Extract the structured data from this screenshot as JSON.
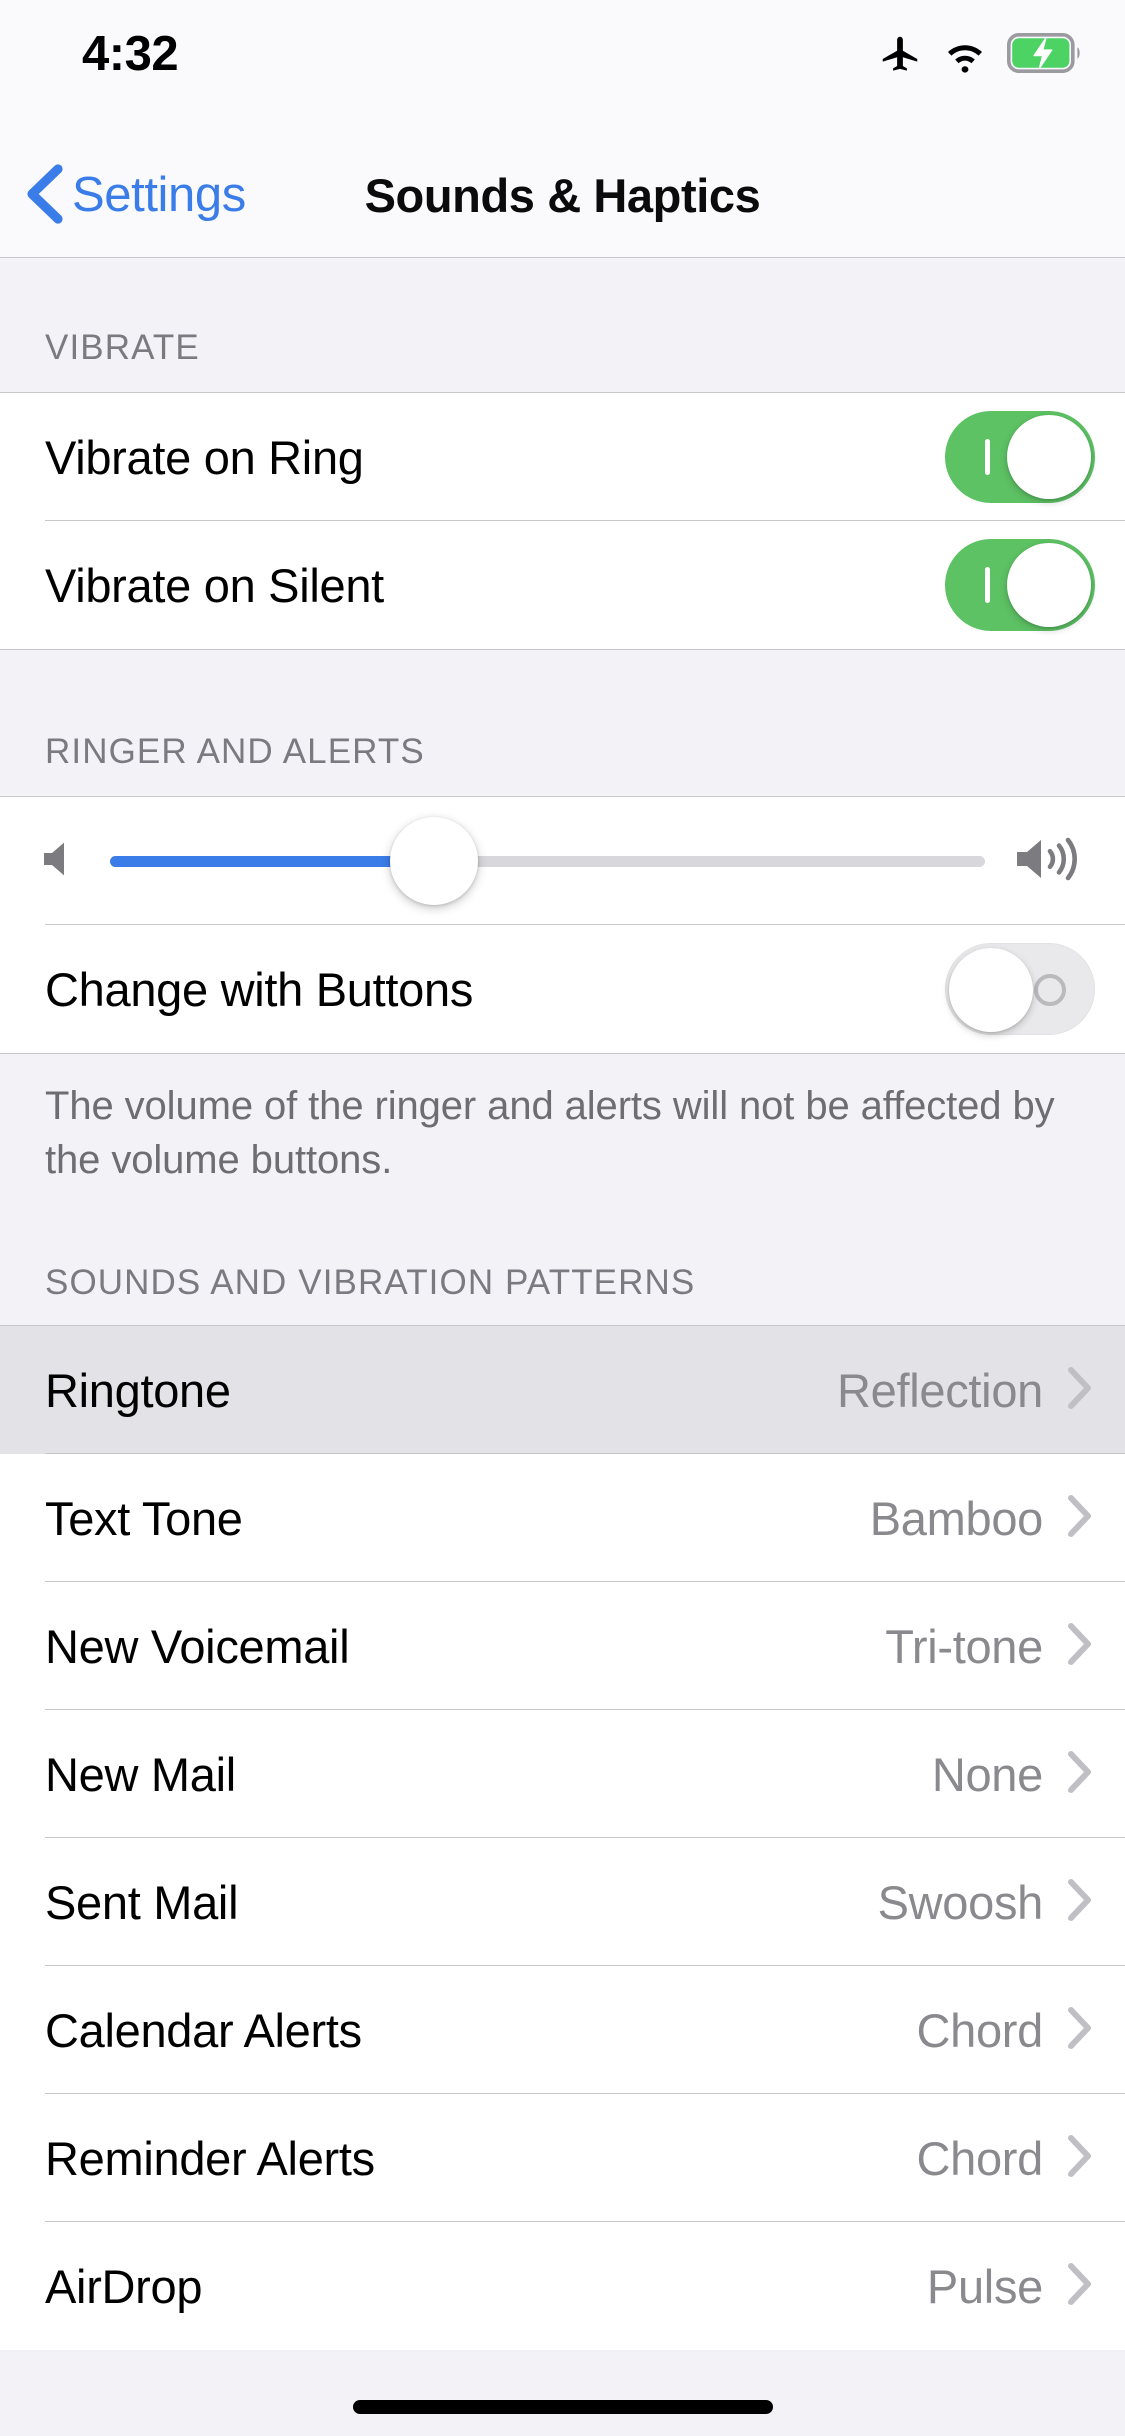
{
  "status_bar": {
    "time": "4:32",
    "icons": [
      "airplane-mode-icon",
      "wifi-icon",
      "battery-charging-icon"
    ],
    "battery_color": "#4CD364"
  },
  "nav_bar": {
    "back_label": "Settings",
    "back_icon": "chevron-left-icon",
    "title": "Sounds & Haptics",
    "accent_color": "#3A7DE8"
  },
  "sections": {
    "vibrate": {
      "header": "VIBRATE",
      "rows": [
        {
          "label": "Vibrate on Ring",
          "toggle": "on"
        },
        {
          "label": "Vibrate on Silent",
          "toggle": "on"
        }
      ]
    },
    "ringer_and_alerts": {
      "header": "RINGER AND ALERTS",
      "slider": {
        "left_icon": "speaker-low-icon",
        "right_icon": "speaker-high-icon",
        "value_percent": 37,
        "fill_color": "#3A7DE8"
      },
      "change_with_buttons": {
        "label": "Change with Buttons",
        "toggle": "off"
      },
      "footer": "The volume of the ringer and alerts will not be affected by the volume buttons."
    },
    "sounds_and_vibration_patterns": {
      "header": "SOUNDS AND VIBRATION PATTERNS",
      "rows": [
        {
          "label": "Ringtone",
          "value": "Reflection",
          "selected": true
        },
        {
          "label": "Text Tone",
          "value": "Bamboo",
          "selected": false
        },
        {
          "label": "New Voicemail",
          "value": "Tri-tone",
          "selected": false
        },
        {
          "label": "New Mail",
          "value": "None",
          "selected": false
        },
        {
          "label": "Sent Mail",
          "value": "Swoosh",
          "selected": false
        },
        {
          "label": "Calendar Alerts",
          "value": "Chord",
          "selected": false
        },
        {
          "label": "Reminder Alerts",
          "value": "Chord",
          "selected": false
        },
        {
          "label": "AirDrop",
          "value": "Pulse",
          "selected": false
        }
      ]
    }
  },
  "home_indicator": "home-indicator-bar"
}
